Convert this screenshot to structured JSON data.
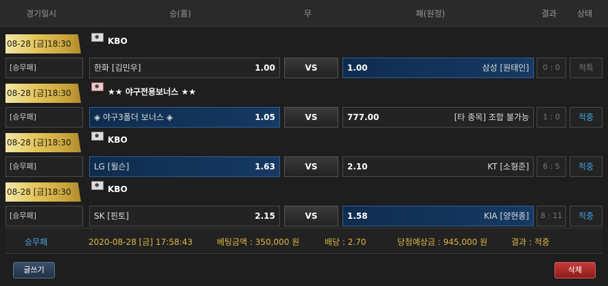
{
  "header": {
    "date": "경기일시",
    "home": "승(홈)",
    "draw": "무",
    "away": "패(원정)",
    "result": "결과",
    "status": "상태"
  },
  "games": [
    {
      "date": "08-28 [금]18:30",
      "league": "KBO",
      "type": "[승무패]",
      "home_name": "한화 [김민우]",
      "home_odds": "1.00",
      "vs": "VS",
      "away_odds": "1.00",
      "away_name": "삼성 [원태인]",
      "score": "0 : 0",
      "status": "적특",
      "selected": "away"
    },
    {
      "date": "08-28 [금]18:30",
      "league": "★★ 야구전용보너스 ★★",
      "type": "[승무패]",
      "home_name": "◈ 야구3폴더 보너스 ◈",
      "home_odds": "1.05",
      "vs": "VS",
      "away_odds": "777.00",
      "away_name": "[타 종목] 조합 불가능",
      "score": "1 : 0",
      "status": "적중",
      "selected": "home"
    },
    {
      "date": "08-28 [금]18:30",
      "league": "KBO",
      "type": "[승무패]",
      "home_name": "LG [윌슨]",
      "home_odds": "1.63",
      "vs": "VS",
      "away_odds": "2.10",
      "away_name": "KT [소형준]",
      "score": "6 : 5",
      "status": "적중",
      "selected": "home"
    },
    {
      "date": "08-28 [금]18:30",
      "league": "KBO",
      "type": "[승무패]",
      "home_name": "SK [핀토]",
      "home_odds": "2.15",
      "vs": "VS",
      "away_odds": "1.58",
      "away_name": "KIA [양현종]",
      "score": "8 : 11",
      "status": "적중",
      "selected": "away"
    }
  ],
  "summary": {
    "type": "승무패",
    "datetime": "2020-08-28 [금] 17:58:43",
    "bet_amount": "베팅금액 : 350,000 원",
    "odds": "배당 : 2.70",
    "expected": "당첨예상금 : 945,000 원",
    "result": "결과 : 적중"
  },
  "buttons": {
    "write": "글쓰기",
    "delete": "삭제"
  },
  "colors": {
    "selected": "#163a63",
    "hit": "#47a6e8",
    "summary_text": "#e0b843",
    "gold": "#e3c55a",
    "delete": "#c53a3a"
  }
}
